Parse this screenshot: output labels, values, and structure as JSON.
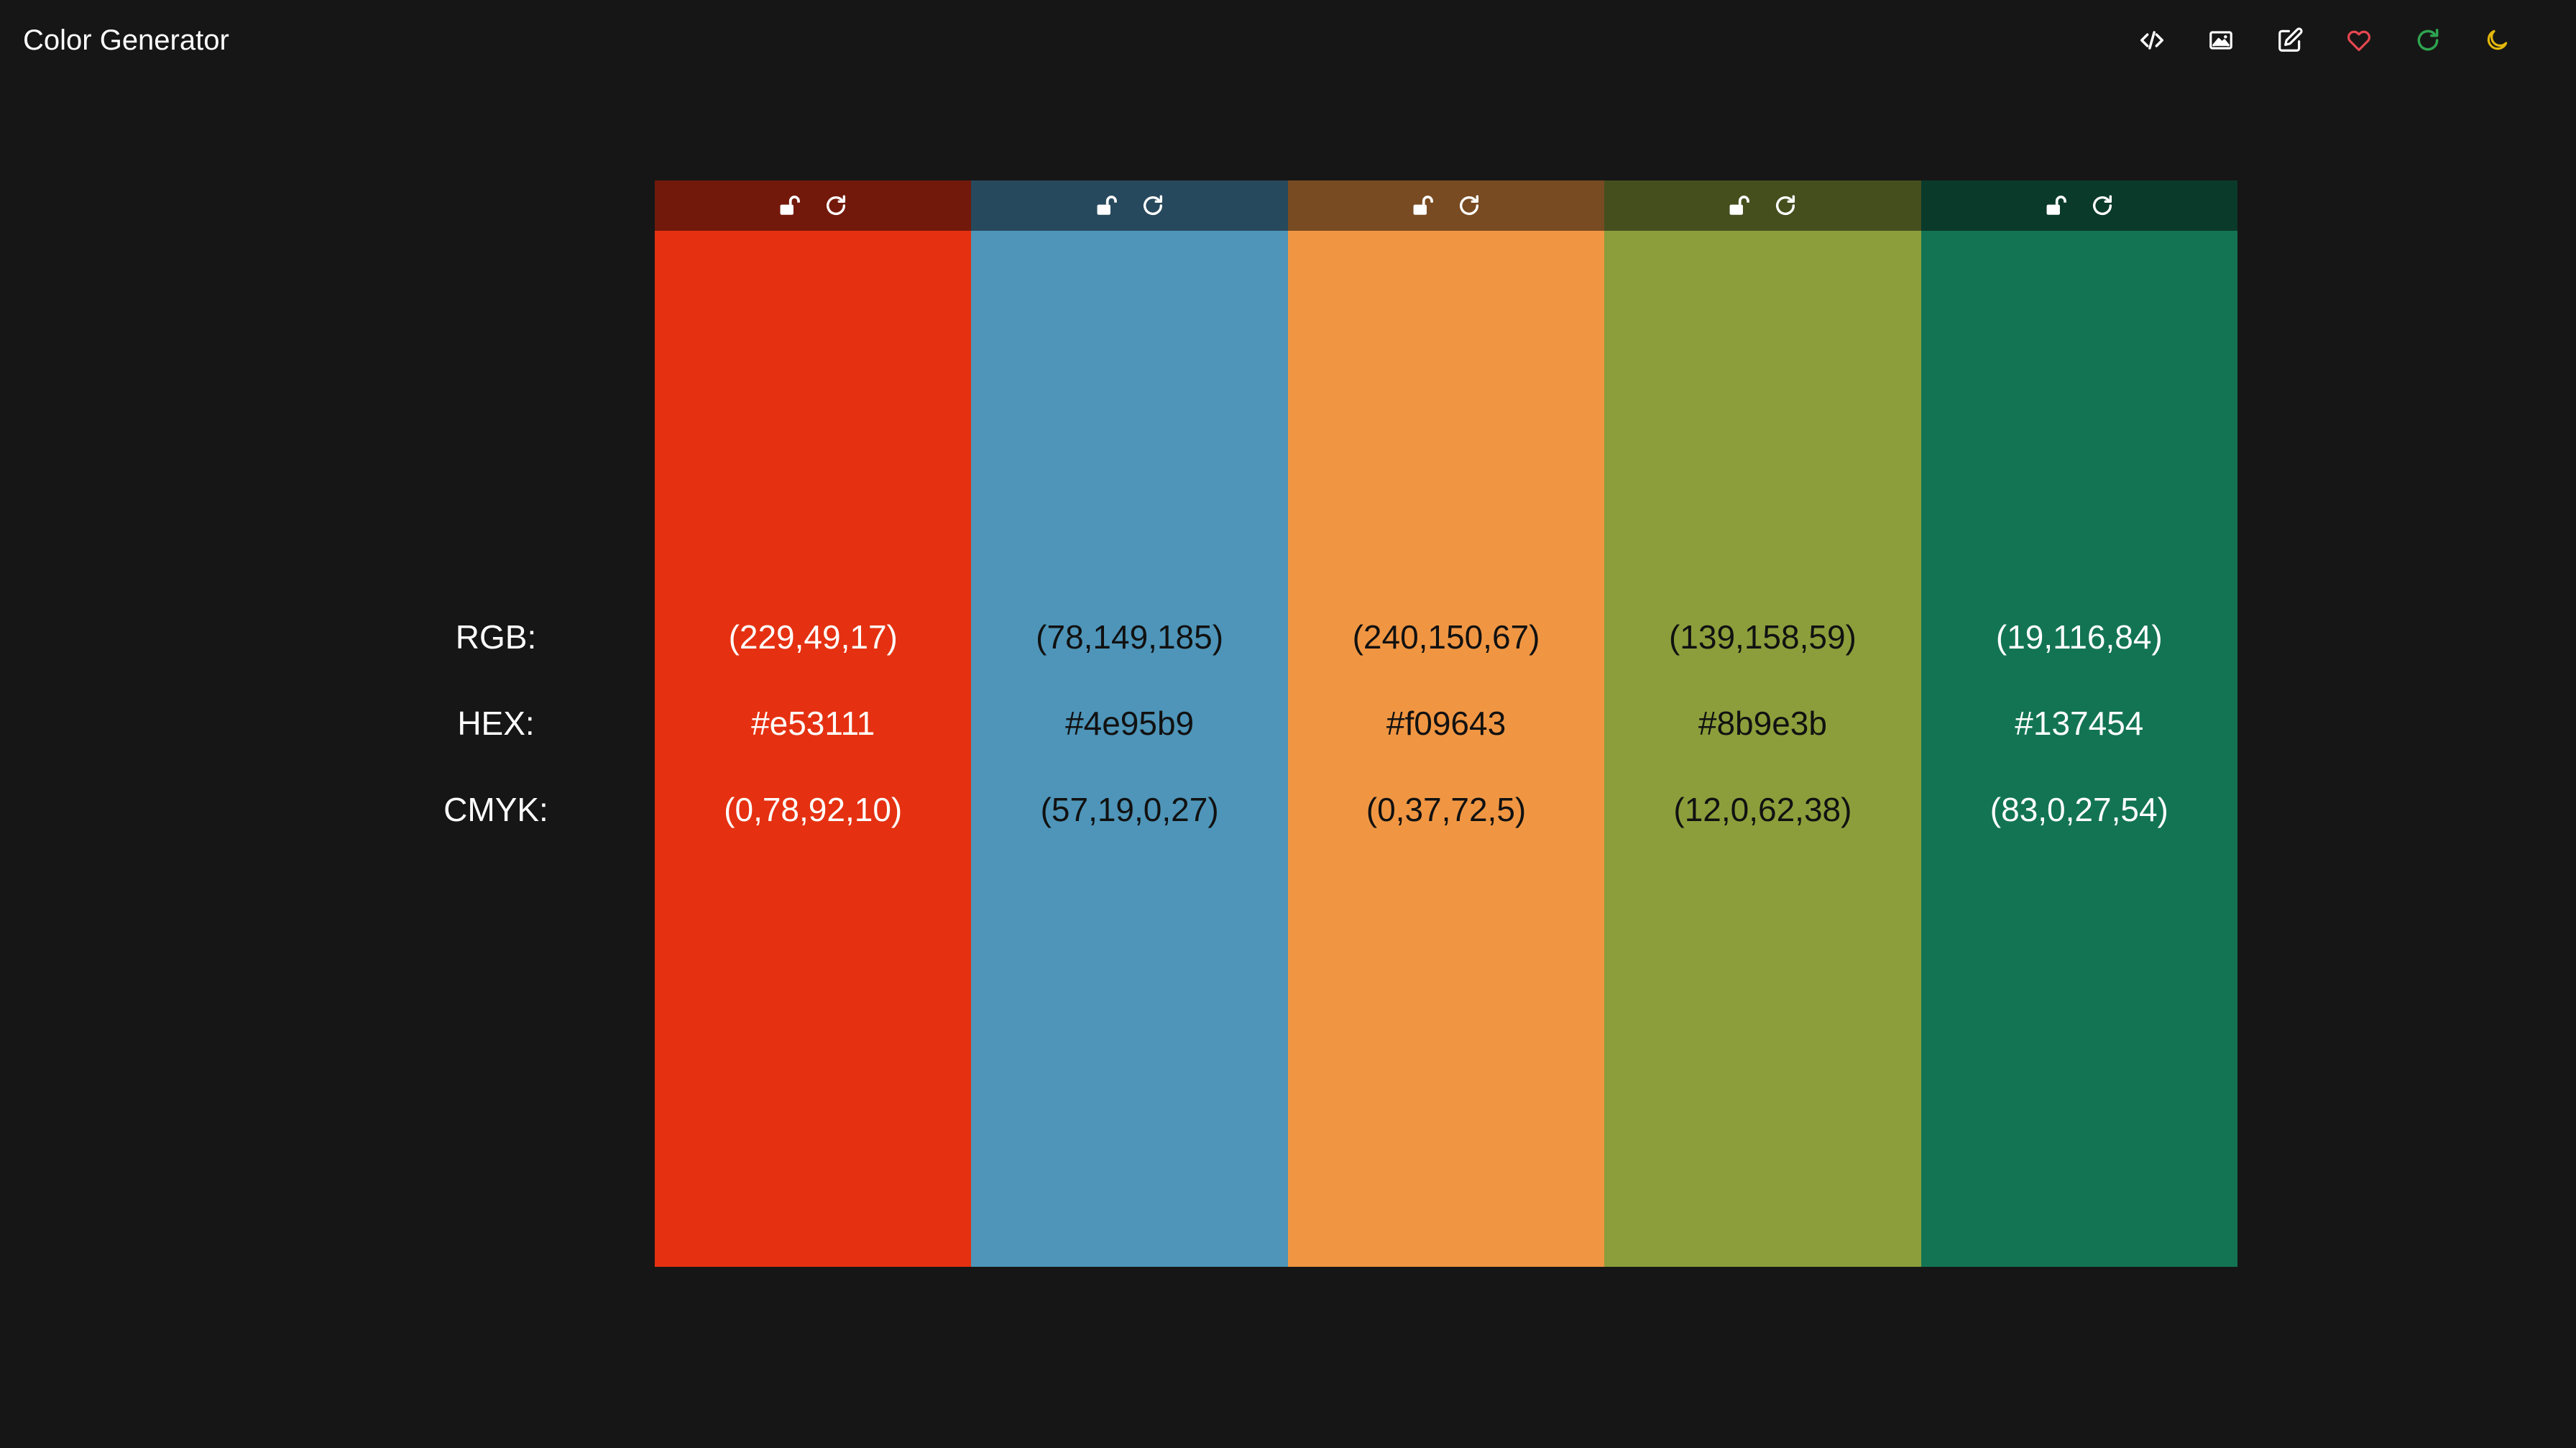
{
  "header": {
    "title": "Color Generator",
    "toolbar": [
      {
        "icon": "code-icon",
        "color": "#ffffff"
      },
      {
        "icon": "image-icon",
        "color": "#ffffff"
      },
      {
        "icon": "edit-icon",
        "color": "#ffffff"
      },
      {
        "icon": "heart-icon",
        "color": "#e5474f"
      },
      {
        "icon": "refresh-icon",
        "color": "#2ea44f"
      },
      {
        "icon": "moon-icon",
        "color": "#e5b80b"
      }
    ]
  },
  "labels": {
    "rgb": "RGB:",
    "hex": "HEX:",
    "cmyk": "CMYK:"
  },
  "swatches": [
    {
      "color": "#e53111",
      "header_color": "#72190b",
      "text_color": "#ffffff",
      "rgb": "(229,49,17)",
      "hex": "#e53111",
      "cmyk": "(0,78,92,10)"
    },
    {
      "color": "#4e95b9",
      "header_color": "#27495d",
      "text_color": "#111111",
      "rgb": "(78,149,185)",
      "hex": "#4e95b9",
      "cmyk": "(57,19,0,27)"
    },
    {
      "color": "#f09643",
      "header_color": "#784b22",
      "text_color": "#111111",
      "rgb": "(240,150,67)",
      "hex": "#f09643",
      "cmyk": "(0,37,72,5)"
    },
    {
      "color": "#8b9e3b",
      "header_color": "#454f1e",
      "text_color": "#111111",
      "rgb": "(139,158,59)",
      "hex": "#8b9e3b",
      "cmyk": "(12,0,62,38)"
    },
    {
      "color": "#137454",
      "header_color": "#0a3a2a",
      "text_color": "#ffffff",
      "rgb": "(19,116,84)",
      "hex": "#137454",
      "cmyk": "(83,0,27,54)"
    }
  ]
}
